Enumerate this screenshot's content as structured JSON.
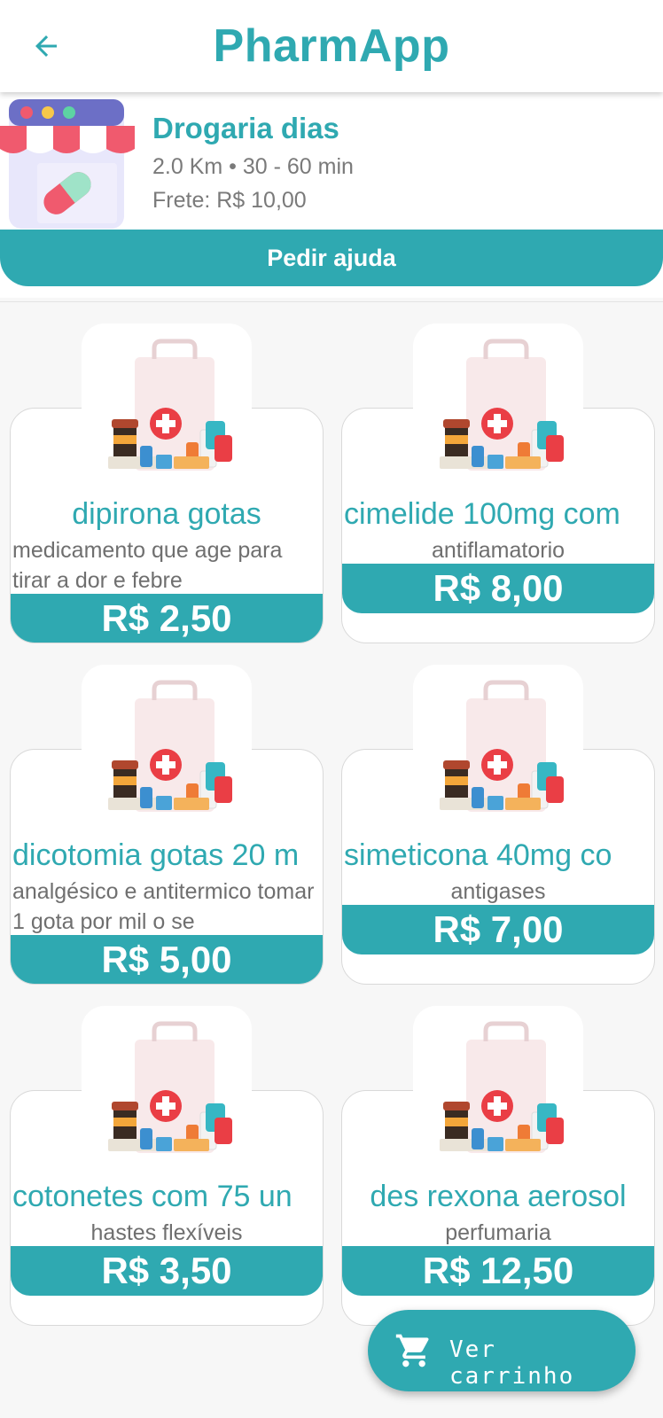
{
  "app": {
    "title": "PharmApp"
  },
  "store": {
    "name": "Drogaria dias",
    "meta": "2.0 Km • 30 - 60 min",
    "fee": "Frete: R$ 10,00",
    "help_label": "Pedir ajuda"
  },
  "products": [
    {
      "name": "dipirona gotas",
      "desc": "medicamento que age para tirar a dor e febre",
      "price": "R$ 2,50"
    },
    {
      "name": "cimelide 100mg com",
      "desc": "antiflamatorio",
      "price": "R$ 8,00"
    },
    {
      "name": "dicotomia gotas 20 m",
      "desc": "analgésico e antitermico tomar 1 gota por mil o se",
      "price": "R$ 5,00"
    },
    {
      "name": "simeticona 40mg co",
      "desc": "antigases",
      "price": "R$ 7,00"
    },
    {
      "name": "cotonetes com 75 un",
      "desc": "hastes flexíveis",
      "price": "R$ 3,50"
    },
    {
      "name": "des rexona aerosol",
      "desc": "perfumaria",
      "price": "R$ 12,50"
    }
  ],
  "cart": {
    "label": "Ver carrinho"
  },
  "icons": {
    "back": "arrow-left-icon",
    "cart": "shopping-cart-icon",
    "store": "pharmacy-store-icon"
  },
  "colors": {
    "accent": "#2fa9b1",
    "text_muted": "#7a7a7a"
  }
}
